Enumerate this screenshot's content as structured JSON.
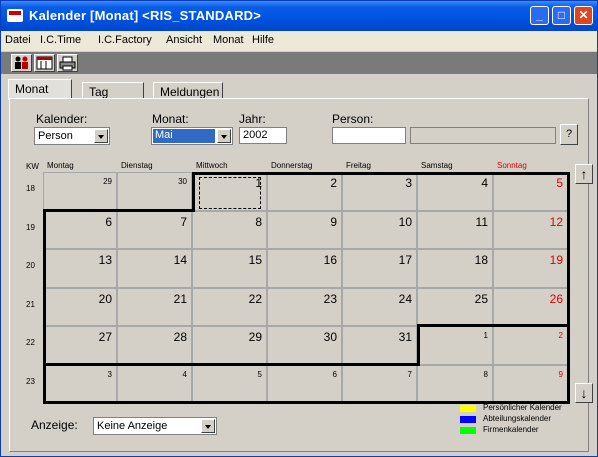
{
  "window": {
    "title": "Kalender [Monat]  <RIS_STANDARD>",
    "min": "_",
    "max": "□",
    "close": "✕"
  },
  "menu": [
    "Datei",
    "I.C.Time",
    "I.C.Factory",
    "Ansicht",
    "Monat",
    "Hilfe"
  ],
  "toolbar_icons": [
    "people-icon",
    "calendar-icon",
    "printer-icon"
  ],
  "tabs": [
    "Monat",
    "Tag",
    "Meldungen"
  ],
  "filters": {
    "kalender_label": "Kalender:",
    "kalender_value": "Person",
    "monat_label": "Monat:",
    "monat_value": "Mai",
    "jahr_label": "Jahr:",
    "jahr_value": "2002",
    "person_label": "Person:",
    "person_value": "",
    "person_help": "?"
  },
  "weekdays": [
    "Montag",
    "Dienstag",
    "Mittwoch",
    "Donnerstag",
    "Freitag",
    "Samstag",
    "Sonntag"
  ],
  "kw_label": "KW",
  "weeks": [
    {
      "kw": "18",
      "days": [
        "29",
        "30",
        "1",
        "2",
        "3",
        "4",
        "5"
      ]
    },
    {
      "kw": "19",
      "days": [
        "6",
        "7",
        "8",
        "9",
        "10",
        "11",
        "12"
      ]
    },
    {
      "kw": "20",
      "days": [
        "13",
        "14",
        "15",
        "16",
        "17",
        "18",
        "19"
      ]
    },
    {
      "kw": "21",
      "days": [
        "20",
        "21",
        "22",
        "23",
        "24",
        "25",
        "26"
      ]
    },
    {
      "kw": "22",
      "days": [
        "27",
        "28",
        "29",
        "30",
        "31",
        "1",
        "2"
      ]
    },
    {
      "kw": "23",
      "days": [
        "3",
        "4",
        "5",
        "6",
        "7",
        "8",
        "9"
      ]
    }
  ],
  "anzeige": {
    "label": "Anzeige:",
    "value": "Keine Anzeige"
  },
  "legend": [
    {
      "label": "Persönlicher Kalender",
      "color": "#ffff00"
    },
    {
      "label": "Abteilungskalender",
      "color": "#0000ff"
    },
    {
      "label": "Firmenkalender",
      "color": "#00ff00"
    }
  ],
  "colors": {
    "sunday": "#e00000",
    "accent": "#316ac5"
  }
}
